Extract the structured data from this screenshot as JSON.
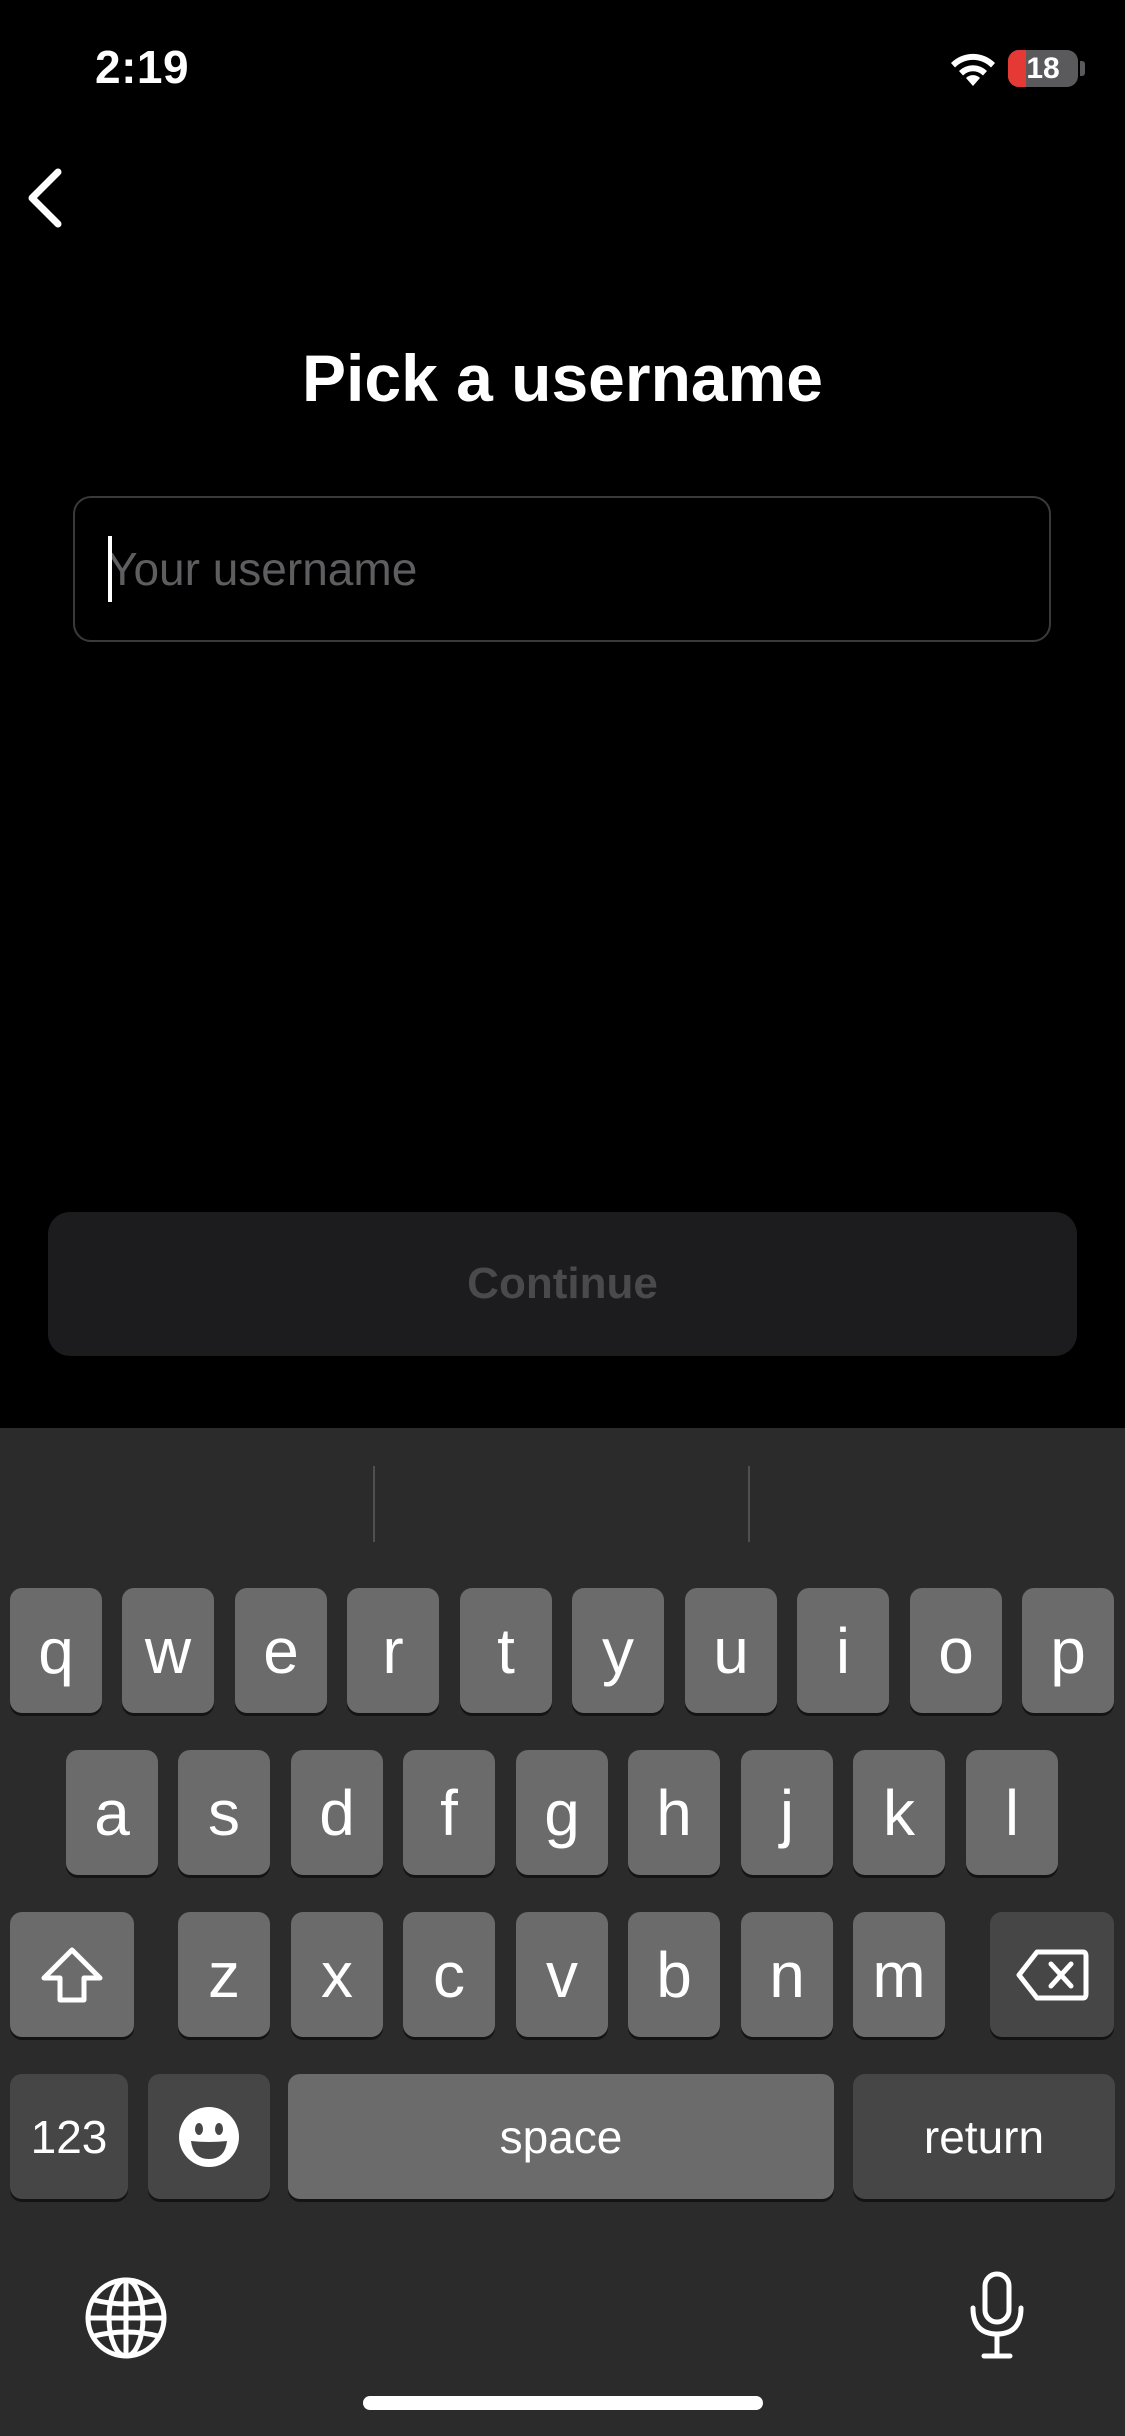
{
  "status_bar": {
    "time": "2:19",
    "battery": "18"
  },
  "header": {
    "title": "Pick a username"
  },
  "form": {
    "username_placeholder": "Your username",
    "continue_label": "Continue"
  },
  "keyboard": {
    "row1": [
      "q",
      "w",
      "e",
      "r",
      "t",
      "y",
      "u",
      "i",
      "o",
      "p"
    ],
    "row2": [
      "a",
      "s",
      "d",
      "f",
      "g",
      "h",
      "j",
      "k",
      "l"
    ],
    "row3": [
      "z",
      "x",
      "c",
      "v",
      "b",
      "n",
      "m"
    ],
    "numbers_label": "123",
    "space_label": "space",
    "return_label": "return"
  },
  "colors": {
    "background": "#000000",
    "keyboard_bg": "#2b2b2b",
    "key": "#6b6b6b",
    "key_dark": "#464646",
    "battery_low": "#e53935"
  }
}
